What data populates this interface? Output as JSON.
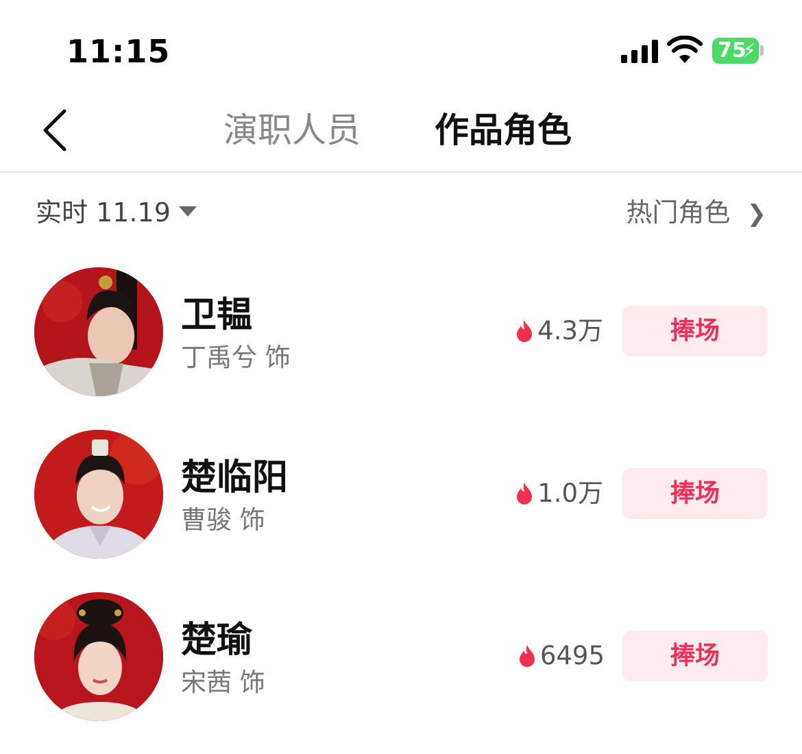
{
  "status_bar": {
    "time": "11:15",
    "battery_level": "75",
    "icons": [
      "signal-icon",
      "wifi-icon",
      "battery-charging-icon"
    ]
  },
  "nav": {
    "back_icon": "chevron-left-icon",
    "tabs": [
      {
        "label": "演职人员",
        "active": false
      },
      {
        "label": "作品角色",
        "active": true
      }
    ]
  },
  "filter": {
    "date_label": "实时 11.19",
    "hot_roles_label": "热门角色",
    "hot_roles_icon": "chevron-right-icon"
  },
  "roles": [
    {
      "name": "卫韫",
      "actor": "丁禹兮 饰",
      "heat": "4.3万",
      "button": "捧场"
    },
    {
      "name": "楚临阳",
      "actor": "曹骏 饰",
      "heat": "1.0万",
      "button": "捧场"
    },
    {
      "name": "楚瑜",
      "actor": "宋茜 饰",
      "heat": "6495",
      "button": "捧场"
    }
  ],
  "colors": {
    "accent": "#ef2f58",
    "button_bg": "#fdebee",
    "flame": "#f0304f",
    "battery": "#4cd964"
  }
}
